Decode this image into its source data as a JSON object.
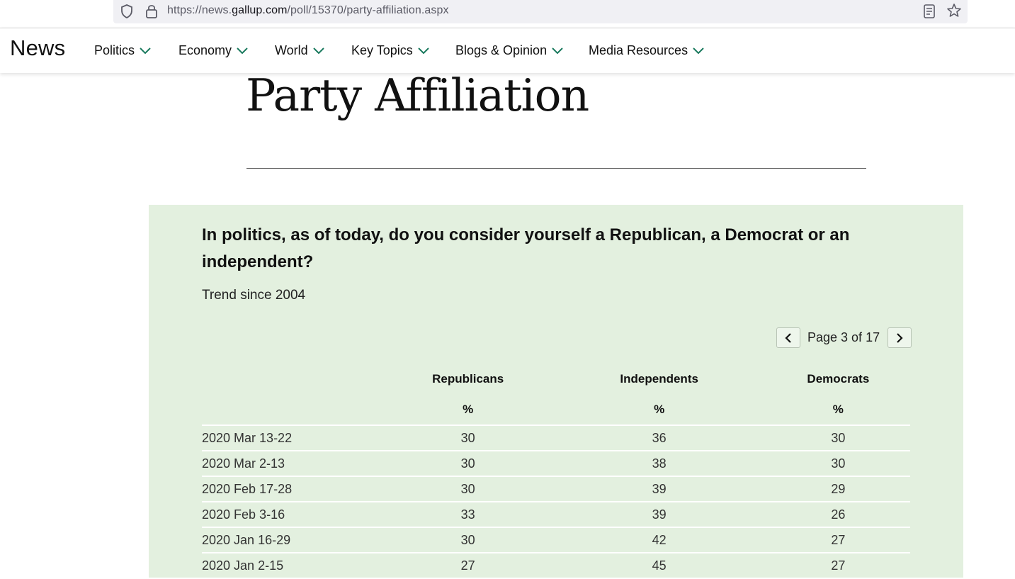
{
  "browser": {
    "url_prefix": "https://news.",
    "url_domain": "gallup.com",
    "url_path": "/poll/15370/party-affiliation.aspx",
    "icons": [
      "shield-icon",
      "lock-icon",
      "reader-view-icon",
      "bookmark-star-icon"
    ]
  },
  "nav": {
    "brand": "News",
    "items": [
      {
        "label": "Politics"
      },
      {
        "label": "Economy"
      },
      {
        "label": "World"
      },
      {
        "label": "Key Topics"
      },
      {
        "label": "Blogs & Opinion"
      },
      {
        "label": "Media Resources"
      }
    ],
    "chevron_color": "#1a7a5e"
  },
  "page": {
    "title": "Party Affiliation"
  },
  "panel": {
    "background": "#e3f0df",
    "question": "In politics, as of today, do you consider yourself a Republican, a Democrat or an independent?",
    "subtitle": "Trend since 2004",
    "pager": {
      "text": "Page 3 of 17"
    },
    "table": {
      "columns": [
        "",
        "Republicans",
        "Independents",
        "Democrats"
      ],
      "units": [
        "",
        "%",
        "%",
        "%"
      ],
      "rows": [
        [
          "2020 Mar 13-22",
          "30",
          "36",
          "30"
        ],
        [
          "2020 Mar 2-13",
          "30",
          "38",
          "30"
        ],
        [
          "2020 Feb 17-28",
          "30",
          "39",
          "29"
        ],
        [
          "2020 Feb 3-16",
          "33",
          "39",
          "26"
        ],
        [
          "2020 Jan 16-29",
          "30",
          "42",
          "27"
        ],
        [
          "2020 Jan 2-15",
          "27",
          "45",
          "27"
        ]
      ]
    }
  }
}
